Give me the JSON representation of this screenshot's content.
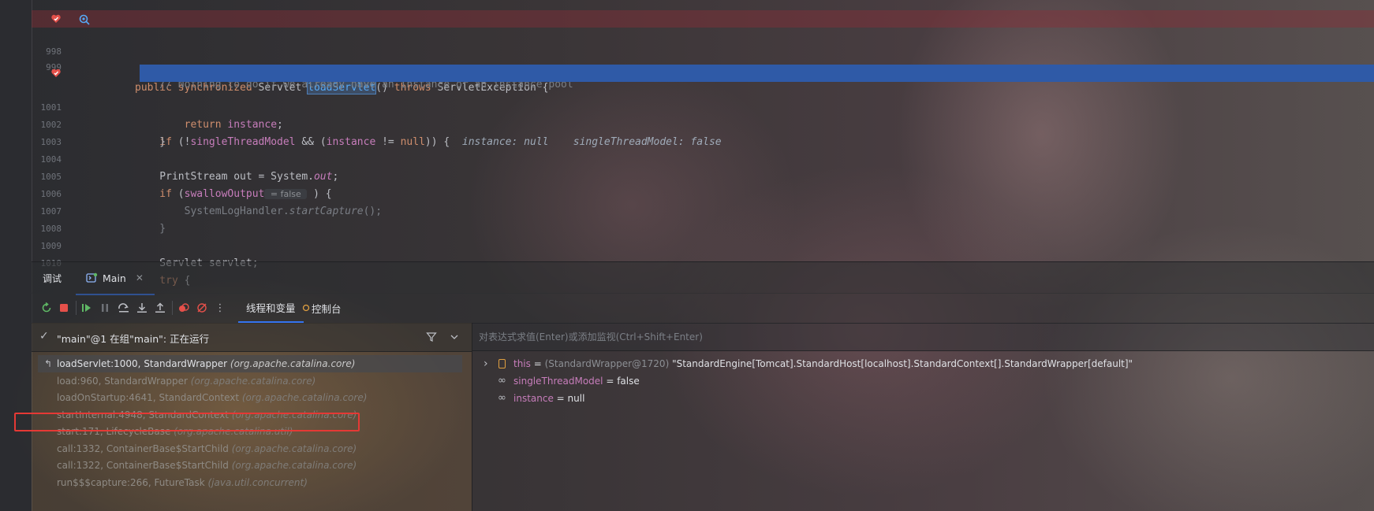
{
  "editor": {
    "lines": [
      {
        "num": "",
        "parts": [
          [
            "kw",
            "public synchronized "
          ],
          [
            "",
            "Servlet "
          ],
          [
            "fn-hl",
            "loadServlet"
          ],
          [
            "",
            "() "
          ],
          [
            "kw",
            "throws "
          ],
          [
            "",
            "ServletException {"
          ]
        ]
      },
      {
        "num": "998",
        "parts": []
      },
      {
        "num": "999",
        "parts": [
          [
            "cmt",
            "    // Nothing to do if we already have an instance or an instance pool"
          ]
        ]
      },
      {
        "num": "",
        "parts": [
          [
            "kw",
            "    if "
          ],
          [
            "",
            "(!"
          ],
          [
            "fld",
            "singleThreadModel"
          ],
          [
            "",
            " && ("
          ],
          [
            "fld",
            "instance"
          ],
          [
            "",
            " != "
          ],
          [
            "kw",
            "null"
          ],
          [
            "",
            ")) {  "
          ],
          [
            "inline-hint",
            "instance: null    singleThreadModel: false"
          ]
        ]
      },
      {
        "num": "1001",
        "parts": [
          [
            "kw",
            "        return "
          ],
          [
            "fld",
            "instance"
          ],
          [
            "",
            ";"
          ]
        ]
      },
      {
        "num": "1002",
        "parts": [
          [
            "",
            "    }"
          ]
        ]
      },
      {
        "num": "1003",
        "parts": []
      },
      {
        "num": "1004",
        "parts": [
          [
            "",
            "    PrintStream out = System."
          ],
          [
            "sfld",
            "out"
          ],
          [
            "",
            ";"
          ]
        ]
      },
      {
        "num": "1005",
        "parts": [
          [
            "kw",
            "    if "
          ],
          [
            "",
            "("
          ],
          [
            "fld",
            "swallowOutput"
          ],
          [
            "hint-chip",
            " = false "
          ],
          [
            "",
            " ) {"
          ]
        ]
      },
      {
        "num": "1006",
        "parts": [
          [
            "code-muted",
            "        SystemLogHandler."
          ],
          [
            "code-muted it",
            "startCapture"
          ],
          [
            "code-muted",
            "();"
          ]
        ]
      },
      {
        "num": "1007",
        "parts": [
          [
            "code-muted",
            "    }"
          ]
        ]
      },
      {
        "num": "1008",
        "parts": []
      },
      {
        "num": "1009",
        "parts": [
          [
            "",
            "    Servlet servlet;"
          ]
        ]
      },
      {
        "num": "1010",
        "parts": [
          [
            "kw",
            "    try "
          ],
          [
            "",
            "{"
          ]
        ]
      }
    ]
  },
  "debug": {
    "title": "调试",
    "run_tab": "Main",
    "sub_tabs": [
      "线程和变量",
      "控制台"
    ],
    "thread_status": "\"main\"@1 在组\"main\": 正在运行",
    "eval_placeholder": "对表达式求值(Enter)或添加监视(Ctrl+Shift+Enter)",
    "frames": [
      {
        "method": "loadServlet:1000, StandardWrapper ",
        "pkg": "(org.apache.catalina.core)"
      },
      {
        "method": "load:960, StandardWrapper ",
        "pkg": "(org.apache.catalina.core)"
      },
      {
        "method": "loadOnStartup:4641, StandardContext ",
        "pkg": "(org.apache.catalina.core)"
      },
      {
        "method": "startInternal:4948, StandardContext ",
        "pkg": "(org.apache.catalina.core)"
      },
      {
        "method": "start:171, LifecycleBase ",
        "pkg": "(org.apache.catalina.util)"
      },
      {
        "method": "call:1332, ContainerBase$StartChild ",
        "pkg": "(org.apache.catalina.core)"
      },
      {
        "method": "call:1322, ContainerBase$StartChild ",
        "pkg": "(org.apache.catalina.core)"
      },
      {
        "method": "run$$$capture:266, FutureTask ",
        "pkg": "(java.util.concurrent)"
      }
    ],
    "variables": [
      {
        "name": "this",
        "eq": " = ",
        "type": "(StandardWrapper@1720) ",
        "value": "\"StandardEngine[Tomcat].StandardHost[localhost].StandardContext[].StandardWrapper[default]\""
      },
      {
        "name": "singleThreadModel",
        "eq": " = ",
        "type": "",
        "value": "false"
      },
      {
        "name": "instance",
        "eq": " = ",
        "type": "",
        "value": "null"
      }
    ]
  },
  "colors": {
    "accent": "#3574f0",
    "breakpoint": "#e5504a",
    "exec_line": "#2f5aa7",
    "highlight_box": "#e53935"
  }
}
